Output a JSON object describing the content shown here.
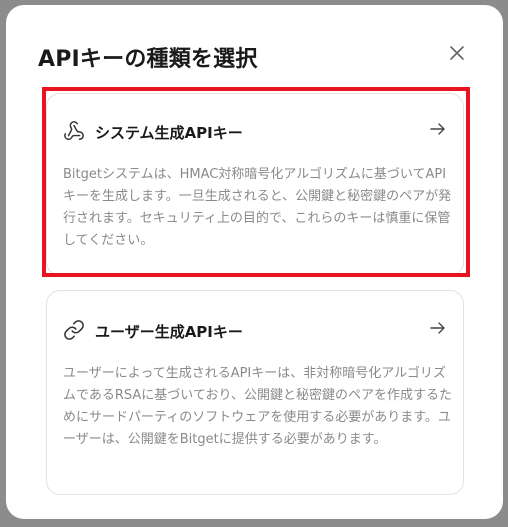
{
  "modal": {
    "title": "APIキーの種類を選択",
    "close_icon": "close-icon"
  },
  "options": [
    {
      "icon": "webhook-icon",
      "title": "システム生成APIキー",
      "description": "Bitgetシステムは、HMAC対称暗号化アルゴリズムに基づいてAPIキーを生成します。一旦生成されると、公開鍵と秘密鍵のペアが発行されます。セキュリティ上の目的で、これらのキーは慎重に保管してください。",
      "highlighted": true
    },
    {
      "icon": "link-icon",
      "title": "ユーザー生成APIキー",
      "description": "ユーザーによって生成されるAPIキーは、非対称暗号化アルゴリズムであるRSAに基づいており、公開鍵と秘密鍵のペアを作成するためにサードパーティのソフトウェアを使用する必要があります。ユーザーは、公開鍵をBitgetに提供する必要があります。",
      "highlighted": false
    }
  ],
  "colors": {
    "highlight": "#e8141e",
    "text_primary": "#1a1a1a",
    "text_secondary": "#8a8a8a"
  }
}
